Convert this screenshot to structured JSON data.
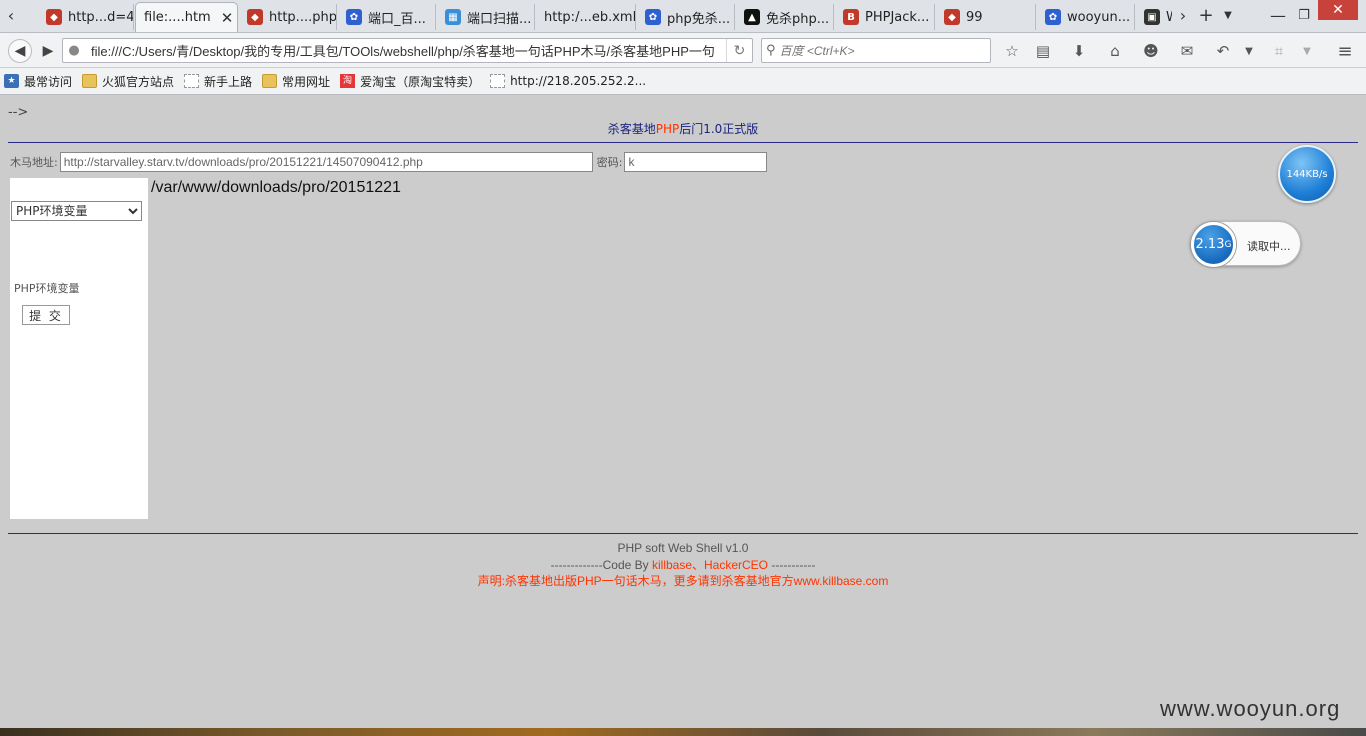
{
  "tabs": [
    {
      "label": "http...d=4",
      "icon": "shield-icon",
      "color": "#c0392b"
    },
    {
      "label": "file:....htm",
      "icon": "page-icon",
      "color": "#888888",
      "active": true
    },
    {
      "label": "http....php",
      "icon": "shield-icon",
      "color": "#c0392b"
    },
    {
      "label": "端口_百...",
      "icon": "paw-icon",
      "color": "#2f5fd1"
    },
    {
      "label": "端口扫描...",
      "icon": "app-icon",
      "color": "#3a8fd8"
    },
    {
      "label": "http:/...eb.xml",
      "icon": "page-icon",
      "color": "#888888"
    },
    {
      "label": "php免杀...",
      "icon": "paw-icon",
      "color": "#2f5fd1"
    },
    {
      "label": "免杀php...",
      "icon": "cap-icon",
      "color": "#111111"
    },
    {
      "label": "PHPJack...",
      "icon": "b-icon",
      "color": "#c0392b"
    },
    {
      "label": "99",
      "icon": "shield-icon",
      "color": "#c0392b"
    },
    {
      "label": "wooyun...",
      "icon": "paw-icon",
      "color": "#2f5fd1"
    },
    {
      "label": "W",
      "icon": "w-icon",
      "color": "#333333"
    }
  ],
  "nav": {
    "url": "file:///C:/Users/青/Desktop/我的专用/工具包/TOOls/webshell/php/杀客基地一句话PHP木马/杀客基地PHP一句",
    "search_placeholder": "百度 <Ctrl+K>"
  },
  "bookmarks": [
    {
      "label": "最常访问",
      "icon": "bookmark-star-icon"
    },
    {
      "label": "火狐官方站点",
      "icon": "folder-icon"
    },
    {
      "label": "新手上路",
      "icon": "blank-page-icon"
    },
    {
      "label": "常用网址",
      "icon": "folder-icon"
    },
    {
      "label": "爱淘宝（原淘宝特卖）",
      "icon": "taobao-icon"
    },
    {
      "label": "http://218.205.252.2...",
      "icon": "blank-page-icon"
    }
  ],
  "page": {
    "comment": "-->",
    "title_pre": "杀客基地",
    "title_php": "PHP",
    "title_post": "后门1.0正式版",
    "trojan_label": "木马地址:",
    "trojan_url": "http://starvalley.starv.tv/downloads/pro/20151221/14507090412.php",
    "password_label": "密码:",
    "password_value": "k",
    "select_value": "PHP环境变量",
    "side_label": "PHP环境变量",
    "submit_label": "提 交",
    "path": "/var/www/downloads/pro/20151221",
    "footer_line1": "PHP soft Web Shell v1.0",
    "footer_line2_pre": "-------------Code By ",
    "footer_line2_red": "killbase、HackerCEO",
    "footer_line2_post": " -----------",
    "footer_line3": "声明:杀客基地出版PHP一句话木马，更多请到杀客基地官方www.killbase.com"
  },
  "widget": {
    "speed": "144KB/s",
    "memory": "2.13",
    "memory_unit": "G",
    "status": "读取中..."
  },
  "watermark": "www.wooyun.org"
}
